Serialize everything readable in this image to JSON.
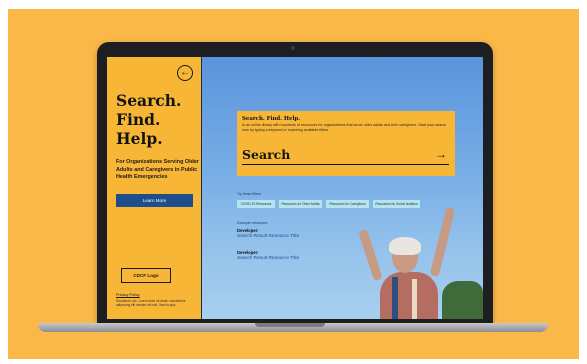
{
  "sidebar": {
    "back_icon": "arrow-left-circle-icon",
    "headline": [
      "Search.",
      "Find.",
      "Help."
    ],
    "tagline": "For Organizations Serving Older Adults and Caregivers in Public Health Emergencies",
    "learn_more": "Learn More",
    "logo_placeholder": "CDCF Logo",
    "privacy": "Privacy Policy",
    "disclaimer": "Disclaimer, etc., lorem dolor sit amet, consectetur adipiscing elit veniam est nisi. Vera in quis"
  },
  "search_card": {
    "title": "Search. Find. Help.",
    "description": "Is an online library with hundreds of resources for organizations that serve older adults and their caregivers. Start your search now by typing a keyword or exploring available filters.",
    "search_label": "Search",
    "arrow_icon": "arrow-right-icon"
  },
  "filters": {
    "label": "Try these filters:",
    "chips": [
      "COVID-19 Resources",
      "Resources for Older Adults",
      "Resources for Caregivers",
      "Resources for Social Isolation"
    ]
  },
  "examples": {
    "label": "Example resources:",
    "items": [
      {
        "developer": "Developer:",
        "title": "Search Result Resource Title"
      },
      {
        "developer": "Developer:",
        "title": "Search Result Resource Title"
      }
    ]
  },
  "colors": {
    "background": "#f9b847",
    "accent": "#f7b636",
    "button": "#1f4e8c",
    "chip": "#b5e3ee"
  }
}
